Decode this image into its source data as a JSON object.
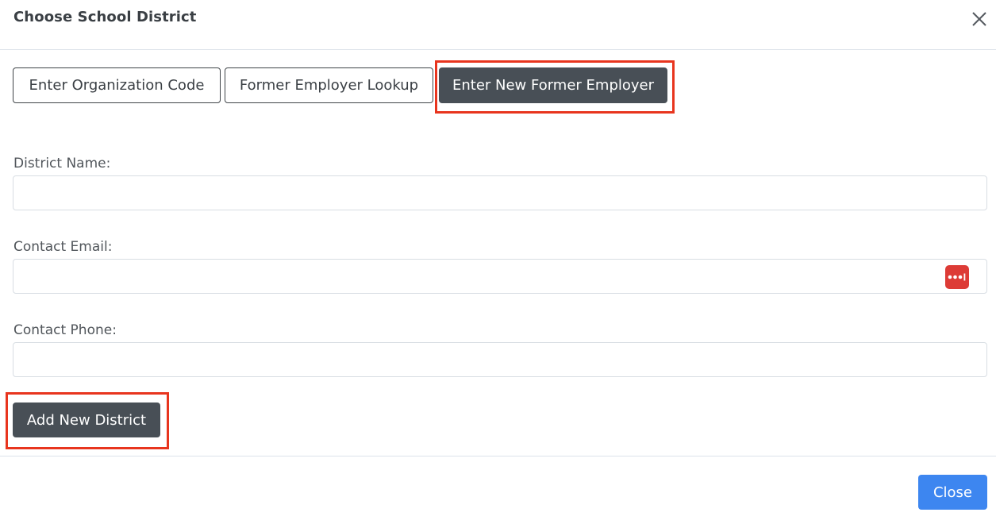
{
  "modal": {
    "title": "Choose School District",
    "close_icon": "close-x-icon"
  },
  "tabs": [
    {
      "label": "Enter Organization Code",
      "active": false
    },
    {
      "label": "Former Employer Lookup",
      "active": false
    },
    {
      "label": "Enter New Former Employer",
      "active": true
    }
  ],
  "form": {
    "district_name": {
      "label": "District Name:",
      "value": "",
      "placeholder": ""
    },
    "contact_email": {
      "label": "Contact Email:",
      "value": "",
      "placeholder": ""
    },
    "contact_phone": {
      "label": "Contact Phone:",
      "value": "",
      "placeholder": ""
    },
    "password_manager_icon": "password-manager-icon",
    "add_button": "Add New District"
  },
  "footer": {
    "close_button": "Close"
  },
  "colors": {
    "active_tab": "#484f56",
    "highlight": "#e8351e",
    "primary": "#3d86f0",
    "password_icon": "#dd3b36"
  }
}
